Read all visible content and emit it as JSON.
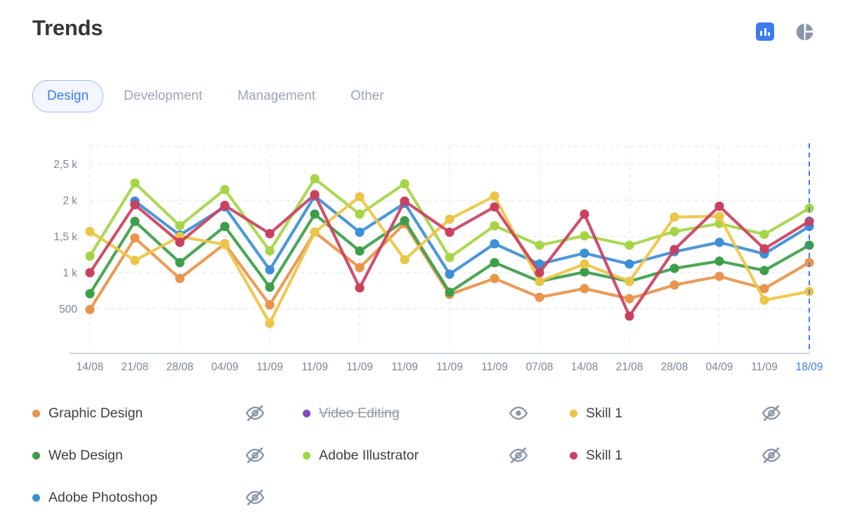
{
  "header": {
    "title": "Trends",
    "actions": [
      {
        "name": "bar-chart-view-button",
        "icon": "bar-chart-icon",
        "active": true
      },
      {
        "name": "pie-chart-view-button",
        "icon": "pie-chart-icon",
        "active": false
      }
    ]
  },
  "tabs": [
    {
      "label": "Design",
      "active": true
    },
    {
      "label": "Development",
      "active": false
    },
    {
      "label": "Management",
      "active": false
    },
    {
      "label": "Other",
      "active": false
    }
  ],
  "colors": {
    "accent": "#3d7cf0",
    "orange": "#e8944a",
    "green": "#3d9e49",
    "blue": "#3d8fd6",
    "purple": "#8b44c4",
    "light_green": "#a5d546",
    "yellow": "#ecc546",
    "crimson": "#ca4160",
    "grid": "#dde3ec",
    "axis_text": "#7b8795"
  },
  "legend": [
    {
      "label": "Graphic Design",
      "color": "#e8944a",
      "visible": true,
      "icon": "eye-off-icon"
    },
    {
      "label": "Video Editing",
      "color": "#8b44c4",
      "visible": false,
      "icon": "eye-icon"
    },
    {
      "label": "Skill 1",
      "color": "#ecc546",
      "visible": true,
      "icon": "eye-off-icon"
    },
    {
      "label": "Web Design",
      "color": "#3d9e49",
      "visible": true,
      "icon": "eye-off-icon"
    },
    {
      "label": "Adobe Illustrator",
      "color": "#a5d546",
      "visible": true,
      "icon": "eye-off-icon"
    },
    {
      "label": "Skill 1",
      "color": "#ca4160",
      "visible": true,
      "icon": "eye-off-icon"
    },
    {
      "label": "Adobe Photoshop",
      "color": "#3d8fd6",
      "visible": true,
      "icon": "eye-off-icon"
    }
  ],
  "chart_data": {
    "type": "line",
    "title": "Trends",
    "xlabel": "",
    "ylabel": "",
    "grid": true,
    "legend_position": "bottom",
    "ylim": [
      0,
      2750
    ],
    "yticks": [
      500,
      1000,
      1500,
      2000,
      2500
    ],
    "ytick_labels": [
      "500",
      "1 k",
      "1,5 k",
      "2 k",
      "2,5 k"
    ],
    "marker_line_x_index": 16,
    "marker_line_color": "#3d7cf0",
    "categories": [
      "14/08",
      "21/08",
      "28/08",
      "04/09",
      "11/09",
      "11/09",
      "11/09",
      "11/09",
      "11/09",
      "11/09",
      "07/08",
      "14/08",
      "21/08",
      "28/08",
      "04/09",
      "11/09",
      "18/09"
    ],
    "series": [
      {
        "name": "Graphic Design",
        "color": "#e8944a",
        "values": [
          490,
          1480,
          920,
          1400,
          555,
          1560,
          1070,
          1680,
          700,
          920,
          660,
          780,
          640,
          830,
          950,
          780,
          1140
        ]
      },
      {
        "name": "Web Design",
        "color": "#3d9e49",
        "values": [
          710,
          1710,
          1140,
          1640,
          800,
          1810,
          1300,
          1720,
          730,
          1140,
          880,
          1010,
          880,
          1060,
          1160,
          1030,
          1380
        ]
      },
      {
        "name": "Adobe Photoshop",
        "color": "#3d8fd6",
        "values": [
          null,
          1990,
          1520,
          1910,
          1040,
          2060,
          1560,
          1960,
          980,
          1400,
          1120,
          1270,
          1120,
          1290,
          1420,
          1260,
          1640
        ]
      },
      {
        "name": "Adobe Illustrator",
        "color": "#a5d546",
        "values": [
          1230,
          2240,
          1650,
          2150,
          1300,
          2300,
          1810,
          2230,
          1210,
          1650,
          1380,
          1510,
          1380,
          1570,
          1680,
          1530,
          1890
        ]
      },
      {
        "name": "Skill 1 (yellow)",
        "color": "#ecc546",
        "values": [
          1570,
          1170,
          1500,
          1390,
          300,
          1560,
          2050,
          1180,
          1740,
          2060,
          880,
          1120,
          880,
          1770,
          1780,
          620,
          740
        ]
      },
      {
        "name": "Skill 1 (crimson)",
        "color": "#ca4160",
        "values": [
          1000,
          1940,
          1420,
          1930,
          1540,
          2080,
          790,
          1990,
          1560,
          1910,
          1000,
          1810,
          400,
          1320,
          1920,
          1330,
          1710
        ]
      }
    ]
  }
}
